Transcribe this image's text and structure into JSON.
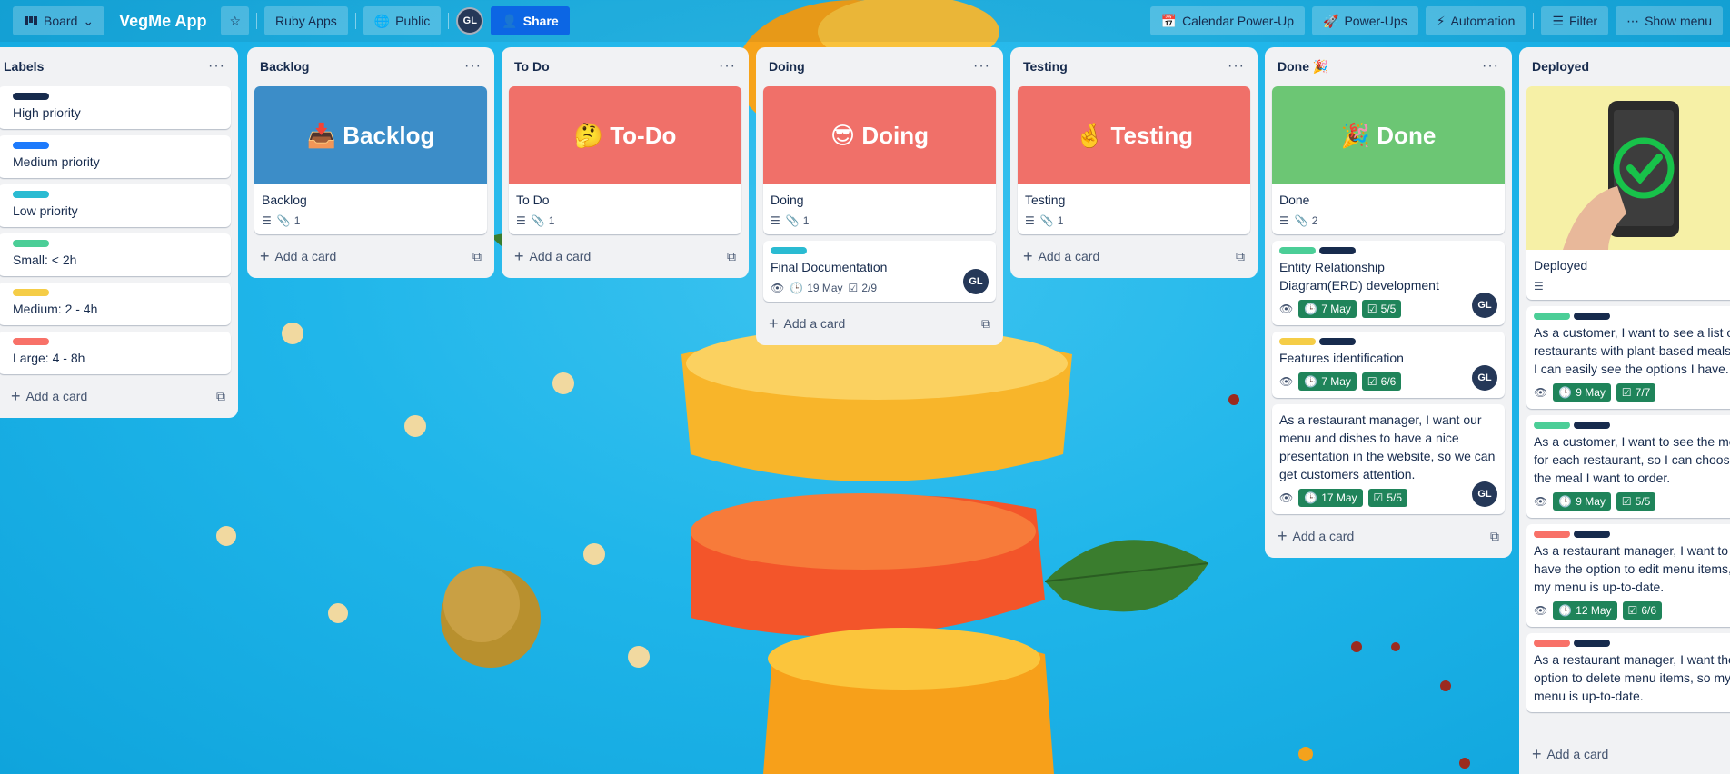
{
  "topbar": {
    "board_view": "Board",
    "title": "VegMe App",
    "workspace": "Ruby Apps",
    "visibility": "Public",
    "avatar": "GL",
    "share": "Share",
    "calendar": "Calendar Power-Up",
    "powerups": "Power-Ups",
    "automation": "Automation",
    "filter": "Filter",
    "show_menu": "Show menu"
  },
  "add_card_label": "Add a card",
  "lists": {
    "labels": {
      "title": "Labels",
      "items": [
        {
          "title": "High priority"
        },
        {
          "title": "Medium priority"
        },
        {
          "title": "Low priority"
        },
        {
          "title": "Small: < 2h"
        },
        {
          "title": "Medium: 2 - 4h"
        },
        {
          "title": "Large: 4 - 8h"
        }
      ]
    },
    "backlog": {
      "title": "Backlog",
      "cover": "📥 Backlog",
      "card_title": "Backlog",
      "attachments": "1"
    },
    "todo": {
      "title": "To Do",
      "cover": "🤔 To-Do",
      "card_title": "To Do",
      "attachments": "1"
    },
    "doing": {
      "title": "Doing",
      "cover": "😎 Doing",
      "card_title": "Doing",
      "attachments": "1",
      "card2": {
        "title": "Final Documentation",
        "date": "19 May",
        "checklist": "2/9",
        "member": "GL"
      }
    },
    "testing": {
      "title": "Testing",
      "cover": "🤞 Testing",
      "card_title": "Testing",
      "attachments": "1"
    },
    "done": {
      "title": "Done 🎉",
      "cover": "🎉 Done",
      "card_title": "Done",
      "attachments": "2",
      "cards": [
        {
          "title": "Entity Relationship Diagram(ERD) development",
          "date": "7 May",
          "checklist": "5/5",
          "member": "GL"
        },
        {
          "title": "Features identification",
          "date": "7 May",
          "checklist": "6/6",
          "member": "GL"
        },
        {
          "title": "As a restaurant manager, I want our menu and dishes to have a nice presentation in the website, so we can get customers attention.",
          "date": "17 May",
          "checklist": "5/5",
          "member": "GL"
        }
      ]
    },
    "deployed": {
      "title": "Deployed",
      "card_title": "Deployed",
      "cards": [
        {
          "title": "As a customer, I want to see a list of restaurants with plant-based meals, so I can easily see the options I have.",
          "date": "9 May",
          "checklist": "7/7"
        },
        {
          "title": "As a customer, I want to see the menu for each restaurant, so I can choose the meal I want to order.",
          "date": "9 May",
          "checklist": "5/5"
        },
        {
          "title": "As a restaurant manager, I want to have the option to edit menu items, so my menu is up-to-date.",
          "date": "12 May",
          "checklist": "6/6"
        },
        {
          "title": "As a restaurant manager, I want the option to delete menu items, so my menu is up-to-date."
        }
      ]
    }
  },
  "colors": {
    "label_blue": "#0c66e4",
    "label_sky": "#1d7afc",
    "label_cyan": "#2abbd2",
    "label_green": "#4bce97",
    "label_yellow": "#f5cd47",
    "label_red": "#f87168",
    "label_dark": "#172b4d",
    "cover_blue": "#3c8dc8",
    "cover_red": "#f07069",
    "cover_green": "#6cc674",
    "badge_green": "#1f845a"
  }
}
